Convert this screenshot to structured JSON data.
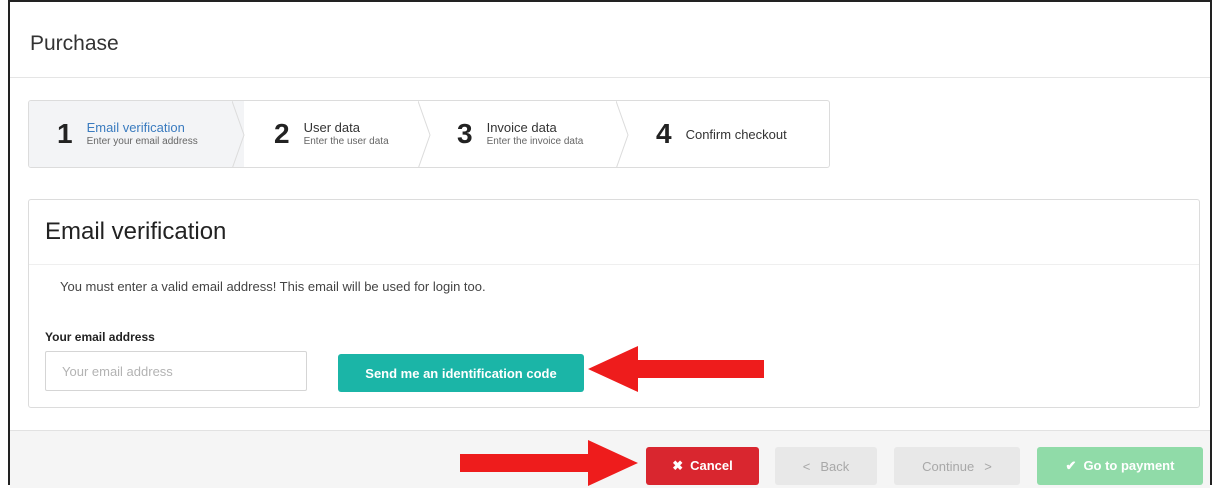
{
  "page": {
    "title": "Purchase"
  },
  "steps": [
    {
      "num": "1",
      "title": "Email verification",
      "sub": "Enter your email address",
      "active": true
    },
    {
      "num": "2",
      "title": "User data",
      "sub": "Enter the user data",
      "active": false
    },
    {
      "num": "3",
      "title": "Invoice data",
      "sub": "Enter the invoice data",
      "active": false
    },
    {
      "num": "4",
      "title": "Confirm checkout",
      "sub": "",
      "active": false
    }
  ],
  "panel": {
    "heading": "Email verification",
    "info": "You must enter a valid email address! This email will be used for login too.",
    "email_label": "Your email address",
    "email_placeholder": "Your email address",
    "email_value": "",
    "send_button": "Send me an identification code"
  },
  "footer": {
    "cancel": "Cancel",
    "back": "Back",
    "continue": "Continue",
    "go_to_payment": "Go to payment"
  },
  "colors": {
    "active_step_title": "#3a7bbf",
    "send_button": "#1bb5a7",
    "cancel_button": "#d9262f",
    "go_to_payment_button": "#90dba8",
    "annotation_arrow": "#ee1c1c"
  },
  "icons": [
    "times-icon",
    "chevron-left-icon",
    "chevron-right-icon",
    "check-icon"
  ]
}
